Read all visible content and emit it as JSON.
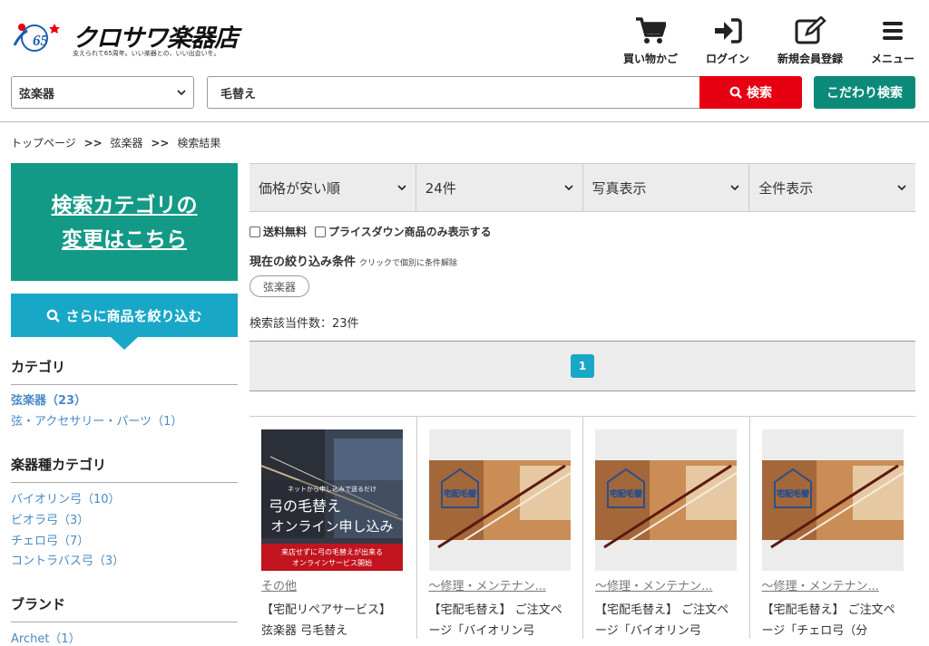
{
  "header": {
    "logo_text": "クロサワ楽器店",
    "logo_anniv": "65",
    "logo_tagline": "支えられて65周年。いい楽器との、いい出会いを。",
    "cart_label": "買い物かご",
    "login_label": "ログイン",
    "register_label": "新規会員登録",
    "menu_label": "メニュー"
  },
  "search": {
    "category_value": "弦楽器",
    "query": "毛替え",
    "search_label": "検索",
    "advanced_label": "こだわり検索"
  },
  "breadcrumb": [
    "トップページ",
    "弦楽器",
    "検索結果"
  ],
  "breadcrumb_sep": ">>",
  "sidebar": {
    "change_category_line1": "検索カテゴリの",
    "change_category_line2": "変更はこちら",
    "narrow_label": "さらに商品を絞り込む",
    "category_heading": "カテゴリ",
    "categories": [
      "弦楽器（23）",
      "弦・アクセサリー・パーツ（1）"
    ],
    "instrument_heading": "楽器種カテゴリ",
    "instruments": [
      "バイオリン弓（10）",
      "ビオラ弓（3）",
      "チェロ弓（7）",
      "コントラバス弓（3）"
    ],
    "brand_heading": "ブランド",
    "brands": [
      "Archet（1）"
    ]
  },
  "sort": {
    "order": "価格が安い順",
    "per_page": "24件",
    "view": "写真表示",
    "filter": "全件表示"
  },
  "filters": {
    "free_shipping": "送料無料",
    "price_down": "プライスダウン商品のみ表示する",
    "current_label": "現在の絞り込み条件",
    "current_hint": "クリックで個別に条件解除",
    "current_tag": "弦楽器",
    "count_text": "検索該当件数：23件"
  },
  "pagination": {
    "current": "1"
  },
  "products": [
    {
      "category": "その他",
      "title": "【宅配リペアサービス】 弦楽器 弓毛替え",
      "banner_small": "ネットから申し込みで送るだけ",
      "banner_line1": "弓の毛替え",
      "banner_line2": "オンライン申し込み",
      "banner_foot1": "来店せずに弓の毛替えが出来る",
      "banner_foot2": "オンラインサービス開始"
    },
    {
      "category": "～修理・メンテナン...",
      "title": "【宅配毛替え】 ご注文ページ「バイオリン弓",
      "stamp": "宅配毛替"
    },
    {
      "category": "～修理・メンテナン...",
      "title": "【宅配毛替え】 ご注文ページ「バイオリン弓",
      "stamp": "宅配毛替"
    },
    {
      "category": "～修理・メンテナン...",
      "title": "【宅配毛替え】 ご注文ページ「チェロ弓（分",
      "stamp": "宅配毛替"
    }
  ],
  "colors": {
    "search_red": "#e60012",
    "teal": "#139a86",
    "blue": "#19a7c8",
    "link_blue": "#4a8ac6"
  }
}
